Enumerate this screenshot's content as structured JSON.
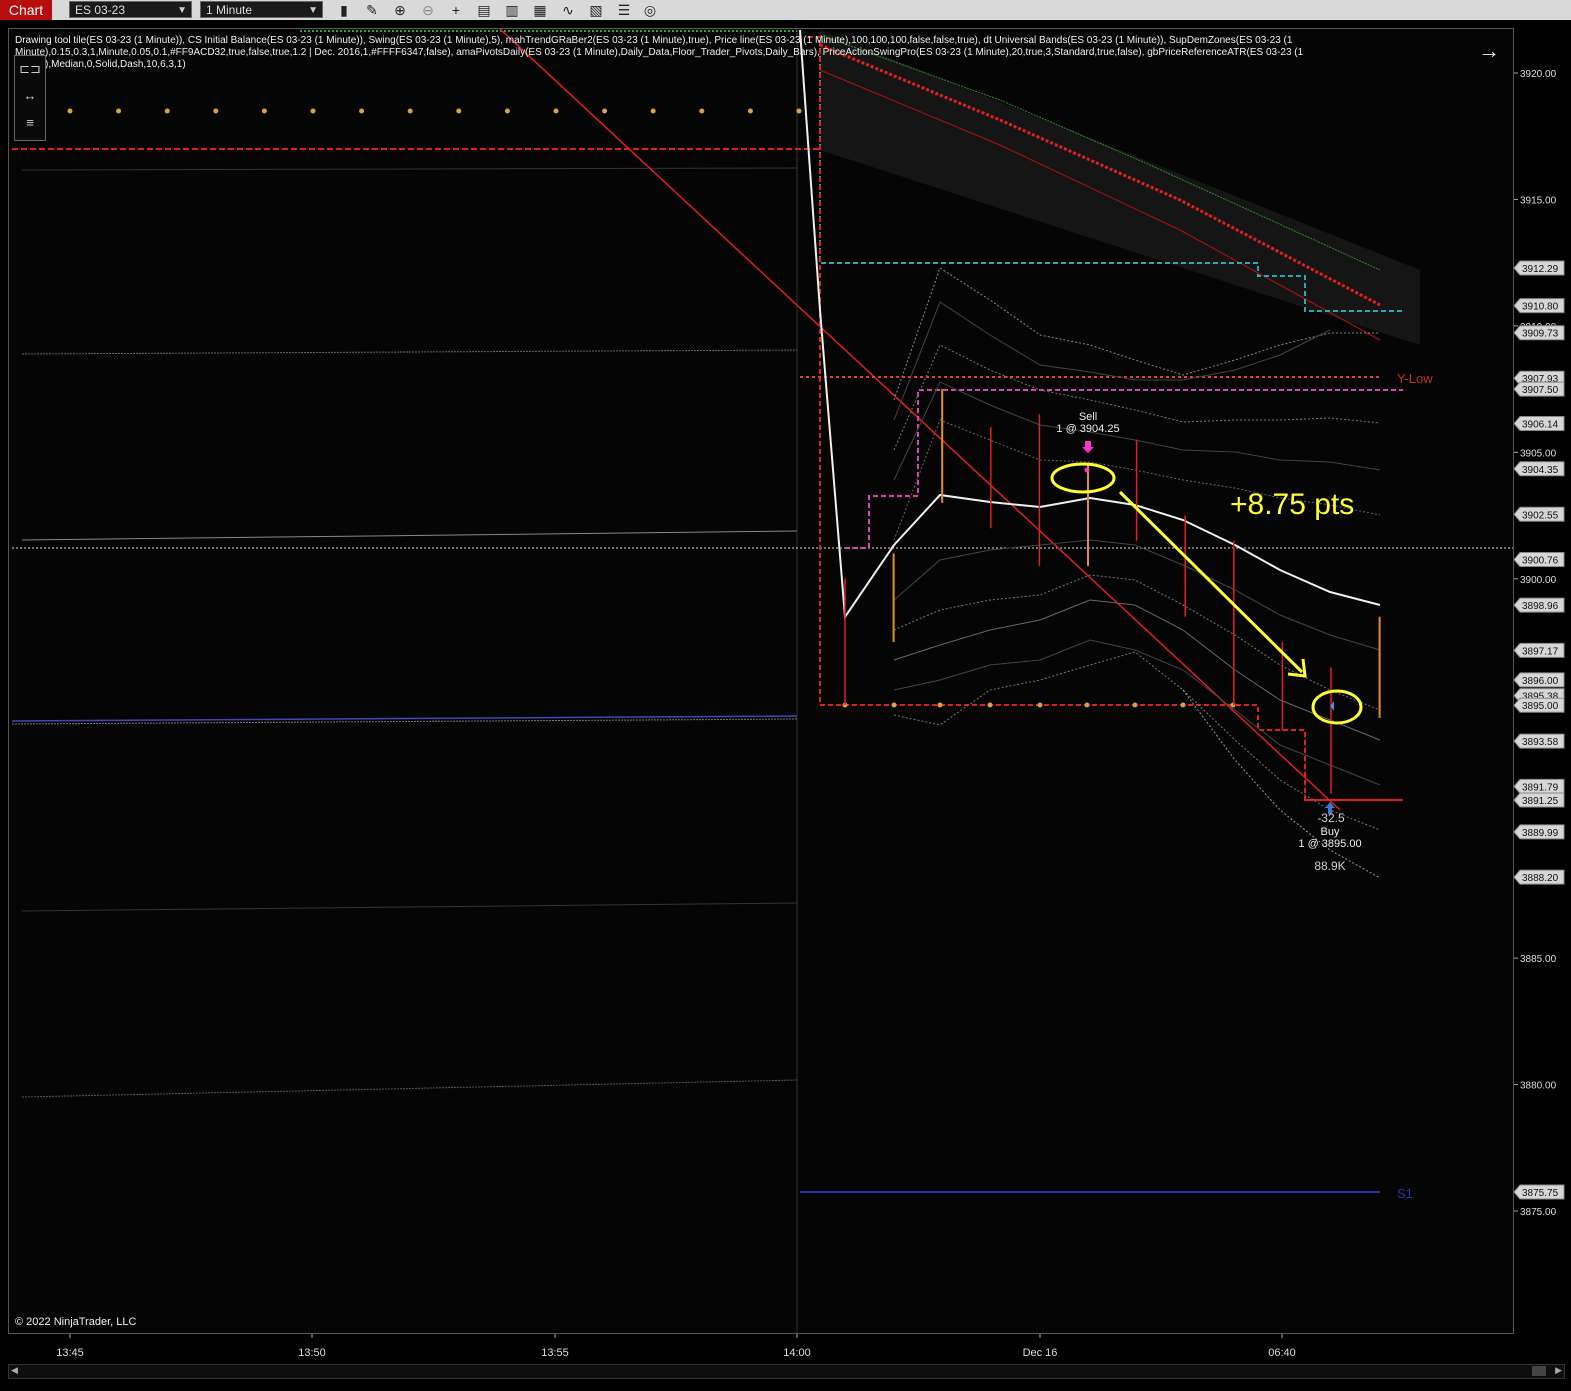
{
  "toolbar": {
    "tab_label": "Chart",
    "instrument": "ES 03-23",
    "interval": "1 Minute",
    "tools": [
      "bar-type-icon",
      "pencil-icon",
      "zoom-in-icon",
      "zoom-out-icon",
      "crosshair-icon",
      "properties-icon",
      "templates-icon",
      "indicators-icon",
      "strategies-icon",
      "chart-trader-icon",
      "data-box-icon",
      "snapshot-icon"
    ]
  },
  "indicators_text": "Drawing tool tile(ES 03-23 (1 Minute)), CS Initial Balance(ES 03-23 (1 Minute)), Swing(ES 03-23 (1 Minute),5), mahTrendGRaBer2(ES 03-23 (1 Minute),true), Price line(ES 03-23 (1 Minute),100,100,100,false,false,true), dt Universal Bands(ES 03-23 (1 Minute)), SupDemZones(ES 03-23 (1 Minute),0.15,0.3,1,Minute,0.05,0.1,#FF9ACD32,true,false,true,1.2 | Dec. 2016,1,#FFFF6347,false), amaPivotsDaily(ES 03-23 (1 Minute),Daily_Data,Floor_Trader_Pivots,Daily_Bars), PriceActionSwingPro(ES 03-23 (1 Minute),20,true,3,Standard,true,false), gbPriceReferenceATR(ES 03-23 (1 Minute),Median,0,Solid,Dash,10,6,3,1)",
  "copyright": "© 2022 NinjaTrader, LLC",
  "price_axis": {
    "ticks": [
      "3920.00",
      "3915.00",
      "3910.00",
      "3905.00",
      "3900.00",
      "3895.00",
      "3890.00",
      "3885.00",
      "3880.00",
      "3875.00"
    ],
    "labels": [
      {
        "text": "3912.29",
        "bg": "#d6d6d6"
      },
      {
        "text": "3910.80",
        "bg": "#d6d6d6"
      },
      {
        "text": "3909.73",
        "bg": "#d6d6d6"
      },
      {
        "text": "3907.93",
        "bg": "#d6d6d6"
      },
      {
        "text": "3907.50",
        "bg": "#d6d6d6"
      },
      {
        "text": "3906.14",
        "bg": "#d6d6d6"
      },
      {
        "text": "3904.35",
        "bg": "#d6d6d6"
      },
      {
        "text": "3902.55",
        "bg": "#d6d6d6"
      },
      {
        "text": "3900.76",
        "bg": "#d6d6d6"
      },
      {
        "text": "3898.96",
        "bg": "#d6d6d6"
      },
      {
        "text": "3897.17",
        "bg": "#d6d6d6"
      },
      {
        "text": "3896.00",
        "bg": "#d6d6d6"
      },
      {
        "text": "3895.38",
        "bg": "#d6d6d6"
      },
      {
        "text": "3895.00",
        "bg": "#d6d6d6"
      },
      {
        "text": "3893.58",
        "bg": "#d6d6d6"
      },
      {
        "text": "3891.79",
        "bg": "#d6d6d6"
      },
      {
        "text": "3891.25",
        "bg": "#d6d6d6"
      },
      {
        "text": "3889.99",
        "bg": "#d6d6d6"
      },
      {
        "text": "3888.20",
        "bg": "#d6d6d6"
      },
      {
        "text": "3875.75",
        "bg": "#d6d6d6"
      }
    ]
  },
  "time_axis": [
    "13:45",
    "13:50",
    "13:55",
    "14:00",
    "Dec 16",
    "06:40"
  ],
  "annotations": {
    "gain": "+8.75 pts",
    "sell_label": "Sell",
    "sell_detail": "1 @ 3904.25",
    "buy_pnl": "-32.5",
    "buy_label": "Buy",
    "buy_detail": "1 @ 3895.00",
    "volume": "88.9K",
    "y_low": "Y-Low",
    "s1": "S1"
  },
  "colors": {
    "background": "#050505",
    "gain_text": "#ffff33",
    "pivot_red": "#e02020",
    "zone_magenta": "#e040b0",
    "teal": "#2aa8b8",
    "s1_blue": "#2a36a0",
    "orange_dot": "#e0a040"
  },
  "chart_data": {
    "type": "bar",
    "x_ticks": [
      "13:45",
      "13:50",
      "13:55",
      "14:00",
      "Dec 16",
      "06:40"
    ],
    "ylim": [
      3870,
      3922
    ],
    "bars": [
      {
        "high": 3900.0,
        "low": 3895.0,
        "color": "red"
      },
      {
        "high": 3901.0,
        "low": 3897.5,
        "color": "orange"
      },
      {
        "high": 3907.5,
        "low": 3903.0,
        "color": "orange"
      },
      {
        "high": 3906.0,
        "low": 3902.0,
        "color": "red"
      },
      {
        "high": 3906.5,
        "low": 3900.5,
        "color": "red"
      },
      {
        "high": 3904.5,
        "low": 3900.5,
        "color": "orange"
      },
      {
        "high": 3905.5,
        "low": 3901.5,
        "color": "red"
      },
      {
        "high": 3902.5,
        "low": 3898.5,
        "color": "red"
      },
      {
        "high": 3901.5,
        "low": 3895.0,
        "color": "red"
      },
      {
        "high": 3897.5,
        "low": 3894.0,
        "color": "red"
      },
      {
        "high": 3896.5,
        "low": 3891.5,
        "color": "red"
      },
      {
        "high": 3898.5,
        "low": 3894.5,
        "color": "orange"
      }
    ]
  }
}
